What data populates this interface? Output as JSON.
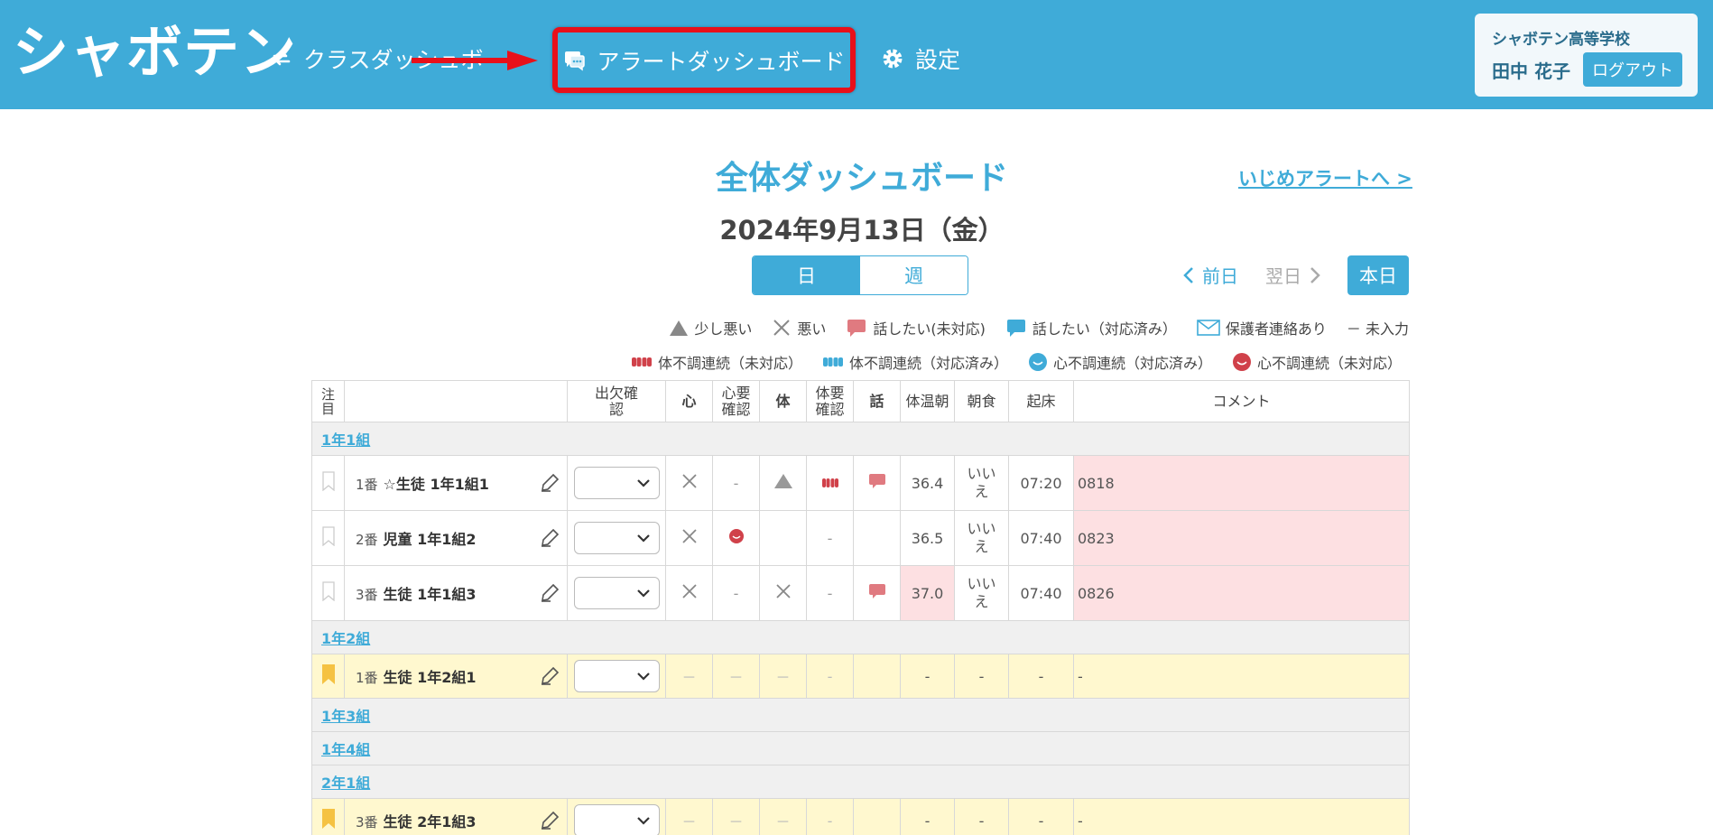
{
  "header": {
    "logo": "シャボテン",
    "nav_class": "クラスダッシュボ",
    "nav_alert": "アラートダッシュボード",
    "nav_settings": "設定",
    "school": "シャボテン高等学校",
    "user": "田中 花子",
    "logout": "ログアウト"
  },
  "page": {
    "title": "全体ダッシュボード",
    "ijime_link": "いじめアラートへ >",
    "date": "2024年9月13日（金）",
    "seg_day": "日",
    "seg_week": "週",
    "prev": "前日",
    "next": "翌日",
    "today": "本日"
  },
  "legend": {
    "l1": "少し悪い",
    "l2": "悪い",
    "l3": "話したい(未対応)",
    "l4": "話したい（対応済み）",
    "l5": "保護者連絡あり",
    "l6": "－ 未入力",
    "l7": "体不調連続（未対応）",
    "l8": "体不調連続（対応済み）",
    "l9": "心不調連続（対応済み）",
    "l10": "心不調連続（未対応）"
  },
  "colors": {
    "primary": "#3fabd8",
    "alert": "#e8101a",
    "pink": "#fde0e2",
    "yellow": "#fff8cf",
    "bookmark": "#f5c242"
  },
  "table": {
    "h_attention": "注目",
    "h_attendance": "出欠確認",
    "h_mind": "心",
    "h_mind_check": "心要確認",
    "h_body": "体",
    "h_body_check": "体要確認",
    "h_talk": "話",
    "h_temp": "体温朝",
    "h_breakfast": "朝食",
    "h_wake": "起床",
    "h_comment": "コメント",
    "g1": "1年1組",
    "g2": "1年2組",
    "g3": "1年3組",
    "g4": "1年4組",
    "g5": "2年1組",
    "r1": {
      "no": "1番",
      "name": "☆生徒 1年1組1",
      "temp": "36.4",
      "breakfast": "いいえ",
      "wake": "07:20",
      "comment": "0818",
      "dash": "-"
    },
    "r2": {
      "no": "2番",
      "name": "児童 1年1組2",
      "temp": "36.5",
      "breakfast": "いいえ",
      "wake": "07:40",
      "comment": "0823",
      "dash": "-"
    },
    "r3": {
      "no": "3番",
      "name": "生徒 1年1組3",
      "temp": "37.0",
      "breakfast": "いいえ",
      "wake": "07:40",
      "comment": "0826",
      "dash": "-",
      "dash2": "-"
    },
    "r4": {
      "no": "1番",
      "name": "生徒 1年2組1",
      "d": "－",
      "h": "-"
    },
    "r5": {
      "no": "3番",
      "name": "生徒 2年1組3",
      "d": "－",
      "h": "-"
    }
  }
}
